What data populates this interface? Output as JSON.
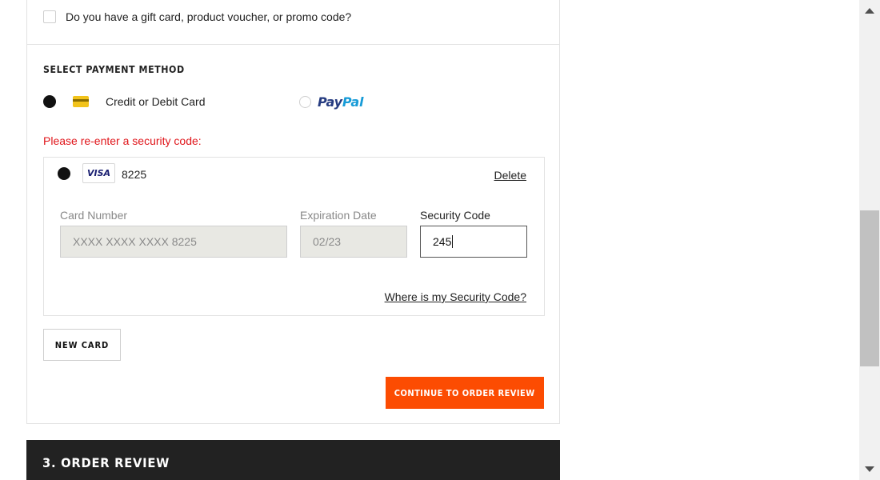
{
  "promo": {
    "label": "Do you have a gift card, product voucher, or promo code?"
  },
  "payment": {
    "section_title": "SELECT PAYMENT METHOD",
    "methods": [
      {
        "label": "Credit or Debit Card",
        "icon": "credit-card-icon",
        "selected": true
      },
      {
        "label": "PayPal",
        "icon": "paypal-logo",
        "selected": false
      }
    ],
    "paypal_logo": {
      "part1": "Pay",
      "part2": "Pal"
    },
    "error_message": "Please re-enter a security code:"
  },
  "saved_card": {
    "brand": "VISA",
    "last4": "8225",
    "delete_label": "Delete",
    "fields": {
      "card_number": {
        "label": "Card Number",
        "value": "XXXX XXXX XXXX 8225"
      },
      "expiration": {
        "label": "Expiration Date",
        "value": "02/23"
      },
      "security_code": {
        "label": "Security Code",
        "value": "245"
      }
    },
    "help_link": "Where is my Security Code?"
  },
  "actions": {
    "new_card_label": "NEW CARD",
    "continue_label": "CONTINUE TO ORDER REVIEW"
  },
  "order_review": {
    "title": "3. ORDER REVIEW"
  },
  "colors": {
    "accent": "#fc4c02",
    "error": "#e0161b",
    "dark_bar": "#222222",
    "paypal_dark": "#253b80",
    "paypal_light": "#179bd7",
    "visa": "#1a1f71"
  }
}
